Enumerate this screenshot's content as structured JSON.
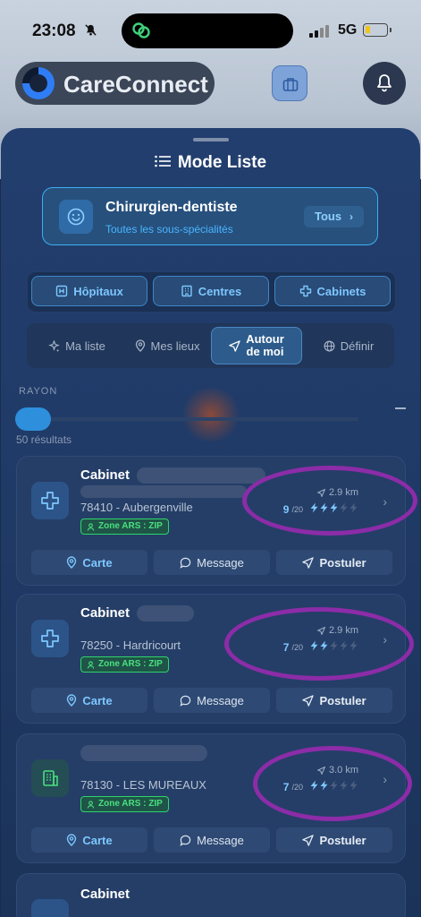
{
  "status_bar": {
    "time": "23:08",
    "network": "5G"
  },
  "header": {
    "brand": "CareConnect"
  },
  "sheet": {
    "title": "Mode Liste",
    "specialty": {
      "title": "Chirurgien-dentiste",
      "subtitle": "Toutes les sous-spécialités",
      "button": "Tous"
    },
    "types": [
      {
        "label": "Hôpitaux"
      },
      {
        "label": "Centres"
      },
      {
        "label": "Cabinets"
      }
    ],
    "filters": [
      {
        "label": "Ma liste"
      },
      {
        "label": "Mes lieux"
      },
      {
        "label": "Autour de moi",
        "line1": "Autour",
        "line2": "de moi"
      },
      {
        "label": "Définir"
      }
    ],
    "radius_label": "RAYON",
    "results": "50 résultats"
  },
  "cards": [
    {
      "name": "Cabinet",
      "city": "78410 - Aubergenville",
      "zone": "Zone ARS : ZIP",
      "distance": "2.9 km",
      "score": "9",
      "score_max": "/20",
      "bolts_filled": 3,
      "bolts_total": 5,
      "icon": "cross-icon"
    },
    {
      "name": "Cabinet",
      "city": "78250 - Hardricourt",
      "zone": "Zone ARS : ZIP",
      "distance": "2.9 km",
      "score": "7",
      "score_max": "/20",
      "bolts_filled": 2,
      "bolts_total": 5,
      "icon": "cross-icon"
    },
    {
      "name": "",
      "city": "78130 - LES MUREAUX",
      "zone": "Zone ARS : ZIP",
      "distance": "3.0 km",
      "score": "7",
      "score_max": "/20",
      "bolts_filled": 2,
      "bolts_total": 5,
      "icon": "building-icon"
    },
    {
      "name": "Cabinet"
    }
  ],
  "actions": {
    "map": "Carte",
    "message": "Message",
    "apply": "Postuler"
  },
  "colors": {
    "accent": "#3db0f0",
    "zone_green": "#4ae07f",
    "highlight_ellipse": "#8c2ca8"
  }
}
